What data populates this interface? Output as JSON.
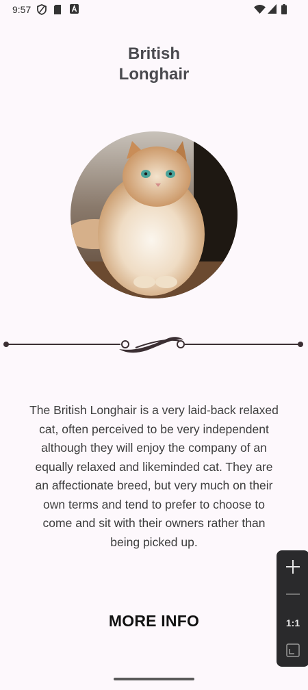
{
  "status_bar": {
    "time": "9:57",
    "left_icons": [
      "shield-icon",
      "sim-card-icon",
      "a-badge-icon"
    ],
    "right_icons": [
      "wifi-icon",
      "signal-icon",
      "battery-icon"
    ]
  },
  "breed": {
    "title_line1": "British",
    "title_line2": "Longhair",
    "photo": "cat-photo",
    "description": "The British Longhair is a very laid-back relaxed cat, often perceived to be very independent although they will enjoy the company of an equally relaxed and likeminded cat. They are an affectionate breed, but very much on their own terms and tend to prefer to choose to come and sit with their owners rather than being picked up."
  },
  "actions": {
    "more_info_label": "MORE INFO"
  },
  "zoom_panel": {
    "zoom_in_icon": "plus-icon",
    "zoom_out_icon": "minus-icon",
    "ratio_label": "1:1",
    "fit_icon": "fit-screen-icon"
  },
  "colors": {
    "background": "#fdf8fc",
    "title": "#4a4a4f",
    "divider": "#3b2f33"
  }
}
